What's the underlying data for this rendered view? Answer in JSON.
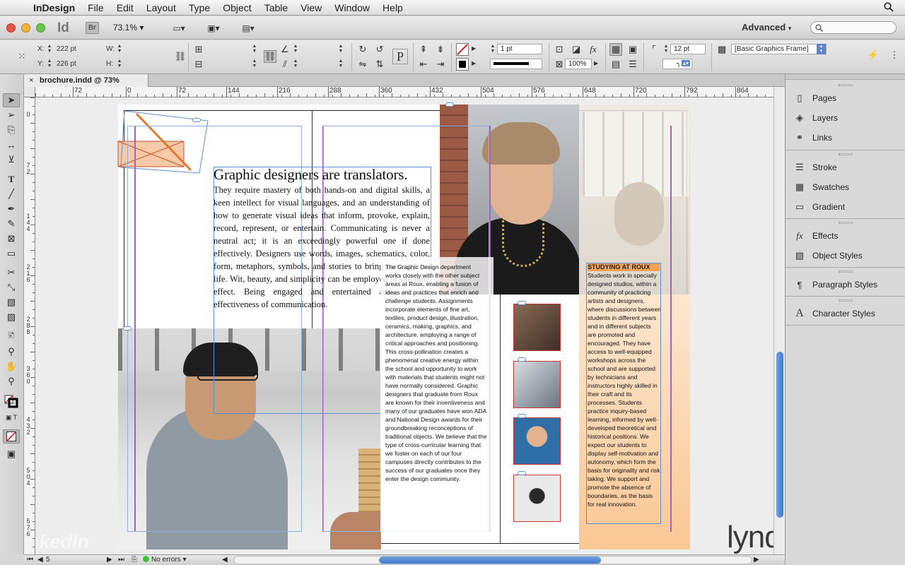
{
  "menubar": {
    "app_name": "InDesign",
    "items": [
      "File",
      "Edit",
      "Layout",
      "Type",
      "Object",
      "Table",
      "View",
      "Window",
      "Help"
    ]
  },
  "appbar": {
    "logo": "Id",
    "bridge": "Br",
    "zoom": "73.1%",
    "workspace": "Advanced"
  },
  "control": {
    "x_label": "X:",
    "x_value": "222 pt",
    "y_label": "Y:",
    "y_value": "226 pt",
    "w_label": "W:",
    "h_label": "H:",
    "stroke_weight": "1 pt",
    "percent": "100%",
    "dimension": "12 pt",
    "object_style": "[Basic Graphics Frame]"
  },
  "document": {
    "tab_title": "brochure.indd @ 73%"
  },
  "rulers": {
    "h": [
      "72",
      "0",
      "72",
      "144",
      "216",
      "288",
      "360",
      "432",
      "504",
      "576",
      "648",
      "720",
      "792",
      "864"
    ],
    "v": [
      "0",
      "7\n2",
      "1\n4\n4",
      "2\n1\n6",
      "2\n8\n8",
      "3\n6\n0",
      "4\n3\n2",
      "5\n0\n4",
      "5\n7\n6"
    ]
  },
  "layout": {
    "headline": "Graphic designers are translators.",
    "body": "They require mastery of both hands-on and digital skills, a keen intellect for visual languages, and an understanding of how to generate visual ideas that inform, provoke, explain, record, represent, or entertain. Communicating is never a neutral act; it is an exceedingly powerful one if done effectively. Designers use words, images, schematics, color, form, metaphors, symbols, and stories to bring messages to life. Wit, beauty, and simplicity can be employed to stunning effect. Being engaged and entertained adds to the effectiveness of communication.",
    "column2": "The Graphic Design department works closely with the other subject areas at Roux, enabling a fusion of ideas and practices that enrich and challenge students. Assignments incorporate elements of fine art, textiles, product design, illustration, ceramics, making, graphics, and architecture, employing a range of critical approaches and positioning. This cross-pollination creates a phenomenal creative energy within the school and opportunity to work with materials that students might not have normally considered. Graphic designers that graduate from Roux are known for their inventiveness and many of our graduates have won ADA and National Design awards for their groundbreaking reconceptions of traditional objects. We believe that the type of cross-curricular learning that we foster on each of our four campuses directly contributes to the success of our graduates once they enter the design community.",
    "sidebar_heading": "STUDYING AT ROUX",
    "sidebar_body": "Students work in specially designed studios, within a community of practicing artists and designers, where discussions between students in different years and in different subjects are promoted and encouraged. They have access to well-equipped workshops across the school and are supported by technicians and instructors highly skilled in their craft and its processes. Students practice inquiry-based learning, informed by well-developed theoretical and historical positions. We expect our students to display self-motivation and autonomy, which form the basis for originality and risk taking. We support and promote the absence of boundaries, as the basis for real innovation."
  },
  "status": {
    "page": "5",
    "errors": "No errors"
  },
  "panels": {
    "group1": [
      "Pages",
      "Layers",
      "Links"
    ],
    "group2": [
      "Stroke",
      "Swatches",
      "Gradient"
    ],
    "group3": [
      "Effects",
      "Object Styles"
    ],
    "group4": [
      "Paragraph Styles"
    ],
    "group5": [
      "Character Styles"
    ]
  },
  "watermarks": {
    "linkedin": "LinkedIn",
    "lynda": "lynda.com"
  },
  "colors": {
    "accent_blue": "#3f7ad2",
    "frame_blue": "#5b8fd1",
    "margin_purple": "#a560c6",
    "sidebar_orange": "#fbd8b4",
    "heading_orange": "#f5a45a"
  }
}
